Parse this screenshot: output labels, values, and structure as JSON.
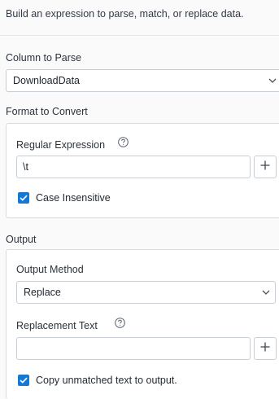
{
  "description": "Build an expression to parse, match, or replace data.",
  "column_to_parse": {
    "label": "Column to Parse",
    "selected": "DownloadData",
    "icon": "chevron-down-icon"
  },
  "format_to_convert": {
    "label": "Format to Convert",
    "regex": {
      "label": "Regular Expression",
      "value": "\\t",
      "help_icon": "question-circle-icon",
      "add_icon": "plus-icon"
    },
    "case_insensitive": {
      "label": "Case Insensitive",
      "checked": true
    }
  },
  "output": {
    "label": "Output",
    "method": {
      "label": "Output Method",
      "selected": "Replace",
      "icon": "chevron-down-icon"
    },
    "replacement": {
      "label": "Replacement Text",
      "value": "",
      "help_icon": "question-circle-icon",
      "add_icon": "plus-icon"
    },
    "copy_unmatched": {
      "label": "Copy unmatched text to output.",
      "checked": true
    }
  },
  "colors": {
    "accent": "#1778d2",
    "border": "#c9ced5",
    "background": "#fafafb",
    "panel": "#ffffff"
  }
}
